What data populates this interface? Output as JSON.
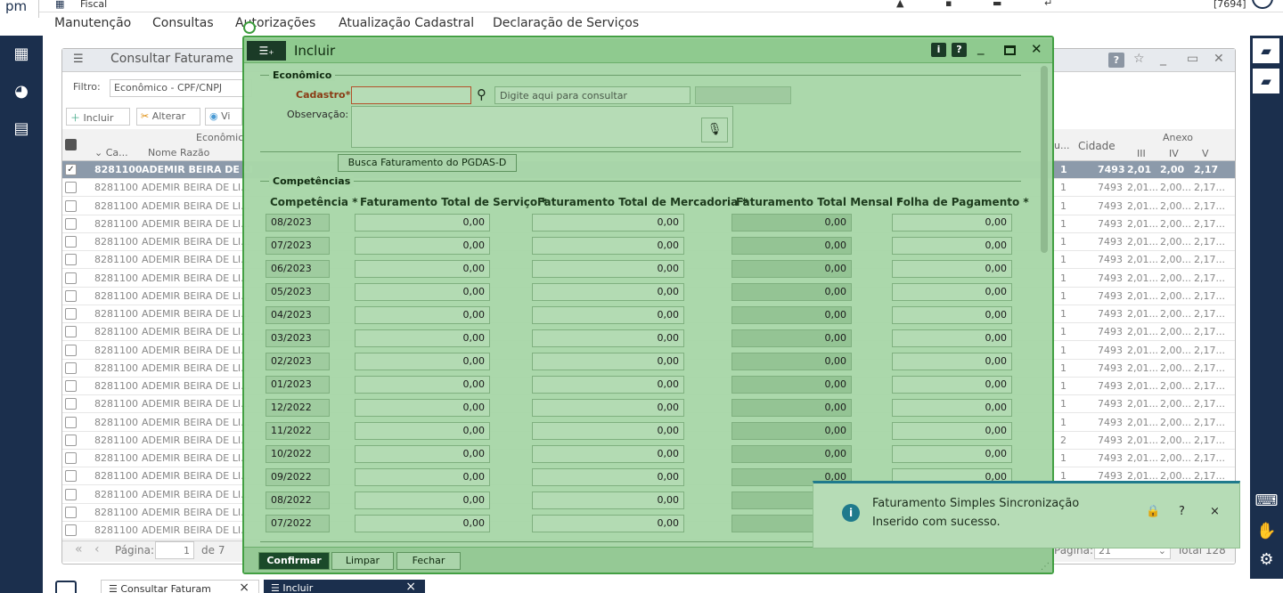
{
  "app": {
    "logo": "pm",
    "title": "Fiscal",
    "user_id": "[7694]"
  },
  "menu": [
    "Manutenção",
    "Consultas",
    "Autorizações",
    "Atualização Cadastral",
    "Declaração de Serviços"
  ],
  "sidebar_icons": [
    "calculator-icon",
    "pie-chart-icon",
    "presentation-icon"
  ],
  "bg_window": {
    "title": "Consultar Faturame",
    "filter_label": "Filtro:",
    "filter_value": "Econômico - CPF/CNPJ",
    "toolbar": {
      "incluir": "Incluir",
      "alterar": "Alterar",
      "visualizar": "Vi"
    },
    "group_header": "Econômic",
    "col_ca": "Ca...",
    "col_nome": "Nome Razão",
    "col_u": "u...",
    "col_cidade": "Cidade",
    "col_anexo": "Anexo",
    "col_iii": "III",
    "col_iv": "IV",
    "col_v": "V",
    "rows": [
      {
        "c": "8281100",
        "n": "ADEMIR BEIRA DE LI",
        "u": "1",
        "cid": "7493",
        "a": "2,01",
        "b": "2,00",
        "v": "2,17",
        "selected": true
      },
      {
        "c": "8281100",
        "n": "ADEMIR BEIRA DE LI...",
        "u": "1",
        "cid": "7493",
        "a": "2,01...",
        "b": "2,00...",
        "v": "2,17..."
      },
      {
        "c": "8281100",
        "n": "ADEMIR BEIRA DE LI...",
        "u": "1",
        "cid": "7493",
        "a": "2,01...",
        "b": "2,00...",
        "v": "2,17..."
      },
      {
        "c": "8281100",
        "n": "ADEMIR BEIRA DE LI...",
        "u": "1",
        "cid": "7493",
        "a": "2,01...",
        "b": "2,00...",
        "v": "2,17..."
      },
      {
        "c": "8281100",
        "n": "ADEMIR BEIRA DE LI...",
        "u": "1",
        "cid": "7493",
        "a": "2,01...",
        "b": "2,00...",
        "v": "2,17..."
      },
      {
        "c": "8281100",
        "n": "ADEMIR BEIRA DE LI...",
        "u": "1",
        "cid": "7493",
        "a": "2,01...",
        "b": "2,00...",
        "v": "2,17..."
      },
      {
        "c": "8281100",
        "n": "ADEMIR BEIRA DE LI...",
        "u": "1",
        "cid": "7493",
        "a": "2,01...",
        "b": "2,00...",
        "v": "2,17..."
      },
      {
        "c": "8281100",
        "n": "ADEMIR BEIRA DE LI...",
        "u": "1",
        "cid": "7493",
        "a": "2,01...",
        "b": "2,00...",
        "v": "2,17..."
      },
      {
        "c": "8281100",
        "n": "ADEMIR BEIRA DE LI...",
        "u": "1",
        "cid": "7493",
        "a": "2,01...",
        "b": "2,00...",
        "v": "2,17..."
      },
      {
        "c": "8281100",
        "n": "ADEMIR BEIRA DE LI...",
        "u": "1",
        "cid": "7493",
        "a": "2,01...",
        "b": "2,00...",
        "v": "2,17..."
      },
      {
        "c": "8281100",
        "n": "ADEMIR BEIRA DE LI...",
        "u": "1",
        "cid": "7493",
        "a": "2,01...",
        "b": "2,00...",
        "v": "2,17..."
      },
      {
        "c": "8281100",
        "n": "ADEMIR BEIRA DE LI...",
        "u": "1",
        "cid": "7493",
        "a": "2,01...",
        "b": "2,00...",
        "v": "2,17..."
      },
      {
        "c": "8281100",
        "n": "ADEMIR BEIRA DE LI...",
        "u": "1",
        "cid": "7493",
        "a": "2,01...",
        "b": "2,00...",
        "v": "2,17..."
      },
      {
        "c": "8281100",
        "n": "ADEMIR BEIRA DE LI...",
        "u": "1",
        "cid": "7493",
        "a": "2,01...",
        "b": "2,00...",
        "v": "2,17..."
      },
      {
        "c": "8281100",
        "n": "ADEMIR BEIRA DE LI...",
        "u": "1",
        "cid": "7493",
        "a": "2,01...",
        "b": "2,00...",
        "v": "2,17..."
      },
      {
        "c": "8281100",
        "n": "ADEMIR BEIRA DE LI...",
        "u": "2",
        "cid": "7493",
        "a": "2,01...",
        "b": "2,00...",
        "v": "2,17..."
      },
      {
        "c": "8281100",
        "n": "ADEMIR BEIRA DE LI...",
        "u": "1",
        "cid": "7493",
        "a": "2,01...",
        "b": "2,00...",
        "v": "2,17..."
      },
      {
        "c": "8281100",
        "n": "ADEMIR BEIRA DE LI...",
        "u": "1",
        "cid": "7493",
        "a": "2,01...",
        "b": "2,00...",
        "v": "2,17..."
      },
      {
        "c": "8281100",
        "n": "ADEMIR BEIRA DE LI...",
        "u": "",
        "cid": "",
        "a": "",
        "b": "",
        "v": ""
      },
      {
        "c": "8281100",
        "n": "ADEMIR BEIRA DE LI...",
        "u": "",
        "cid": "",
        "a": "",
        "b": "",
        "v": ""
      },
      {
        "c": "8281100",
        "n": "ADEMIR BEIRA DE LI...",
        "u": "",
        "cid": "",
        "a": "",
        "b": "",
        "v": ""
      }
    ],
    "page_label": "Página:",
    "page_value": "1",
    "page_of": "de 7",
    "page_label_right": "Página:",
    "page_value_right": "21",
    "total": "Total 128"
  },
  "modal": {
    "title": "Incluir",
    "info_btn": "i",
    "help_btn": "?",
    "section_economico": "Econômico",
    "cadastro_label": "Cadastro*",
    "search_placeholder": "Digite aqui para consultar",
    "observacao_label": "Observação:",
    "busca_button": "Busca Faturamento do PGDAS-D",
    "section_competencias": "Competências",
    "col_competencia": "Competência *",
    "col_servico": "Faturamento Total de Serviço *",
    "col_mercadoria": "Faturamento Total de Mercadoria *",
    "col_mensal": "Faturamento Total Mensal *",
    "col_folha": "Folha de Pagamento *",
    "rows": [
      {
        "comp": "08/2023",
        "serv": "0,00",
        "merc": "0,00",
        "mens": "0,00",
        "folha": "0,00"
      },
      {
        "comp": "07/2023",
        "serv": "0,00",
        "merc": "0,00",
        "mens": "0,00",
        "folha": "0,00"
      },
      {
        "comp": "06/2023",
        "serv": "0,00",
        "merc": "0,00",
        "mens": "0,00",
        "folha": "0,00"
      },
      {
        "comp": "05/2023",
        "serv": "0,00",
        "merc": "0,00",
        "mens": "0,00",
        "folha": "0,00"
      },
      {
        "comp": "04/2023",
        "serv": "0,00",
        "merc": "0,00",
        "mens": "0,00",
        "folha": "0,00"
      },
      {
        "comp": "03/2023",
        "serv": "0,00",
        "merc": "0,00",
        "mens": "0,00",
        "folha": "0,00"
      },
      {
        "comp": "02/2023",
        "serv": "0,00",
        "merc": "0,00",
        "mens": "0,00",
        "folha": "0,00"
      },
      {
        "comp": "01/2023",
        "serv": "0,00",
        "merc": "0,00",
        "mens": "0,00",
        "folha": "0,00"
      },
      {
        "comp": "12/2022",
        "serv": "0,00",
        "merc": "0,00",
        "mens": "0,00",
        "folha": "0,00"
      },
      {
        "comp": "11/2022",
        "serv": "0,00",
        "merc": "0,00",
        "mens": "0,00",
        "folha": "0,00"
      },
      {
        "comp": "10/2022",
        "serv": "0,00",
        "merc": "0,00",
        "mens": "0,00",
        "folha": "0,00"
      },
      {
        "comp": "09/2022",
        "serv": "0,00",
        "merc": "0,00",
        "mens": "0,00",
        "folha": "0,00"
      },
      {
        "comp": "08/2022",
        "serv": "0,00",
        "merc": "0,00",
        "mens": "0,00",
        "folha": "0,00"
      },
      {
        "comp": "07/2022",
        "serv": "0,00",
        "merc": "0,00",
        "mens": "0,00",
        "folha": "0,00"
      }
    ],
    "btn_confirmar": "Confirmar",
    "btn_limpar": "Limpar",
    "btn_fechar": "Fechar"
  },
  "toast": {
    "title": "Faturamento Simples Sincronização",
    "message": "Inserido com sucesso.",
    "help": "?",
    "close": "×"
  },
  "tasks": [
    {
      "label": "Consultar Faturam",
      "close": "×"
    },
    {
      "label": "Incluir",
      "close": "×"
    }
  ],
  "colors": {
    "navy": "#1b2f4d",
    "modal_bg": "#a9d7a9",
    "modal_border": "#3d9d3d",
    "toast_accent": "#1f7a8c"
  }
}
